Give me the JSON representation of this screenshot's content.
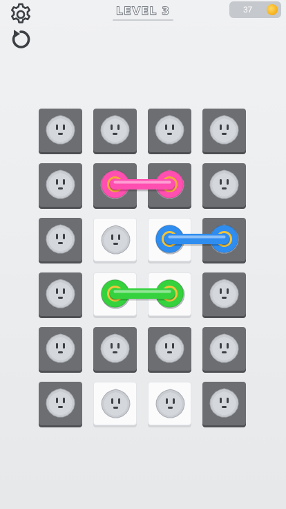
{
  "header": {
    "level_label": "LEVEL 3",
    "coin_count": "37",
    "settings_icon": "gear-icon",
    "restart_icon": "restart-icon",
    "coin_icon": "coin-icon"
  },
  "board": {
    "rows": 6,
    "cols": 4,
    "tiles": [
      [
        "dark",
        "dark",
        "dark",
        "dark"
      ],
      [
        "dark",
        "dark",
        "dark",
        "dark"
      ],
      [
        "dark",
        "light",
        "light",
        "dark"
      ],
      [
        "dark",
        "light",
        "light",
        "dark"
      ],
      [
        "dark",
        "dark",
        "dark",
        "dark"
      ],
      [
        "dark",
        "light",
        "light",
        "dark"
      ]
    ],
    "plugs": [
      {
        "color": "#ff4fb0",
        "ring": "#f2a93b",
        "from": [
          1,
          1
        ],
        "to": [
          1,
          2
        ]
      },
      {
        "color": "#2f8df0",
        "ring": "#f2c33b",
        "from": [
          2,
          2
        ],
        "to": [
          2,
          3
        ]
      },
      {
        "color": "#35d23e",
        "ring": "#f2c33b",
        "from": [
          3,
          1
        ],
        "to": [
          3,
          2
        ]
      }
    ]
  },
  "colors": {
    "pink": "#ff4fb0",
    "blue": "#2f8df0",
    "green": "#35d23e",
    "socket": "#c9ccd1"
  }
}
